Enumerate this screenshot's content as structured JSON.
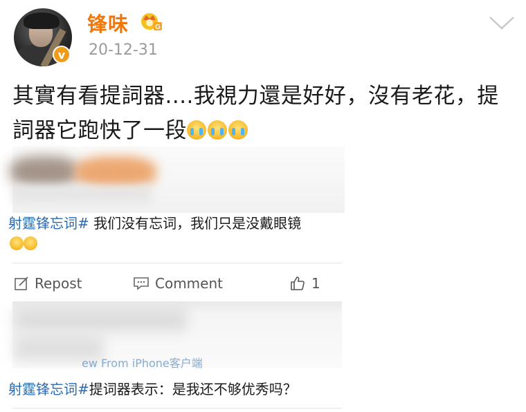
{
  "post": {
    "username": "锋味",
    "time": "20-12-31",
    "text": "其實有看提詞器....我視力還是好好，沒有老花，提詞器它跑快了一段",
    "verified_icon": "v-badge-icon",
    "member_icon": "crown-icon"
  },
  "repost1": {
    "tag": "射霆锋忘词#",
    "text": " 我们没有忘词，我们只是没戴眼镜"
  },
  "actions": {
    "repost_label": "Repost",
    "comment_label": "Comment",
    "like_count": "1"
  },
  "repost2": {
    "source": "ew   From iPhone客户端",
    "tag": "射霆锋忘词#",
    "text": "提词器表示：是我还不够优秀吗？"
  },
  "colors": {
    "accent": "#f0780a",
    "link": "#2a6ab0"
  }
}
